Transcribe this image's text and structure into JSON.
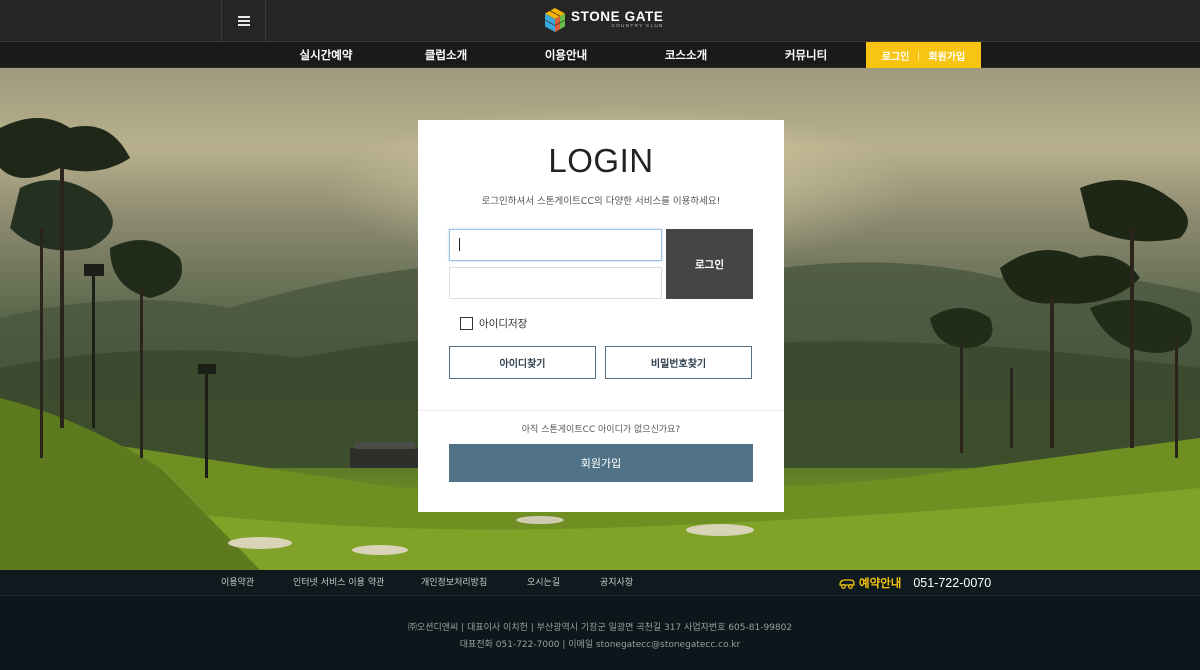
{
  "header": {
    "menu_icon": "hamburger-icon",
    "logo": {
      "name": "STONE GATE",
      "sub": "COUNTRY CLUB",
      "mark_colors": [
        "#e94e3a",
        "#f4b400",
        "#3aa7d9",
        "#6abf4b"
      ]
    }
  },
  "nav": {
    "items": [
      "실시간예약",
      "클럽소개",
      "이용안내",
      "코스소개",
      "커뮤니티"
    ],
    "login": "로그인",
    "signup": "회원가입",
    "accent": "#f6c411"
  },
  "login": {
    "title": "LOGIN",
    "description": "로그인하셔서 스톤게이트CC의 다양한 서비스를 이용하세요!",
    "id_value": "",
    "pw_value": "",
    "submit": "로그인",
    "save_id": "아이디저장",
    "find_id": "아이디찾기",
    "find_pw": "비밀번호찾기",
    "no_account": "아직 스톤게이트CC 아이디가 없으신가요?",
    "join": "회원가입",
    "join_color": "#4f7286"
  },
  "footer": {
    "links": [
      "이용약관",
      "인터넷 서비스 이용 약관",
      "개인정보처리방침",
      "오시는길",
      "공지사항"
    ],
    "reserve_label": "예약안내",
    "reserve_phone": "051-722-0070",
    "info_line1": "㈜오션디앤씨 | 대표이사 이치헌 | 부산광역시 기장군 일광면 곡천길 317 사업자번호 605-81-99802",
    "info_line2": "대표전화 051-722-7000 | 이메일 stonegatecc@stonegatecc.co.kr"
  }
}
